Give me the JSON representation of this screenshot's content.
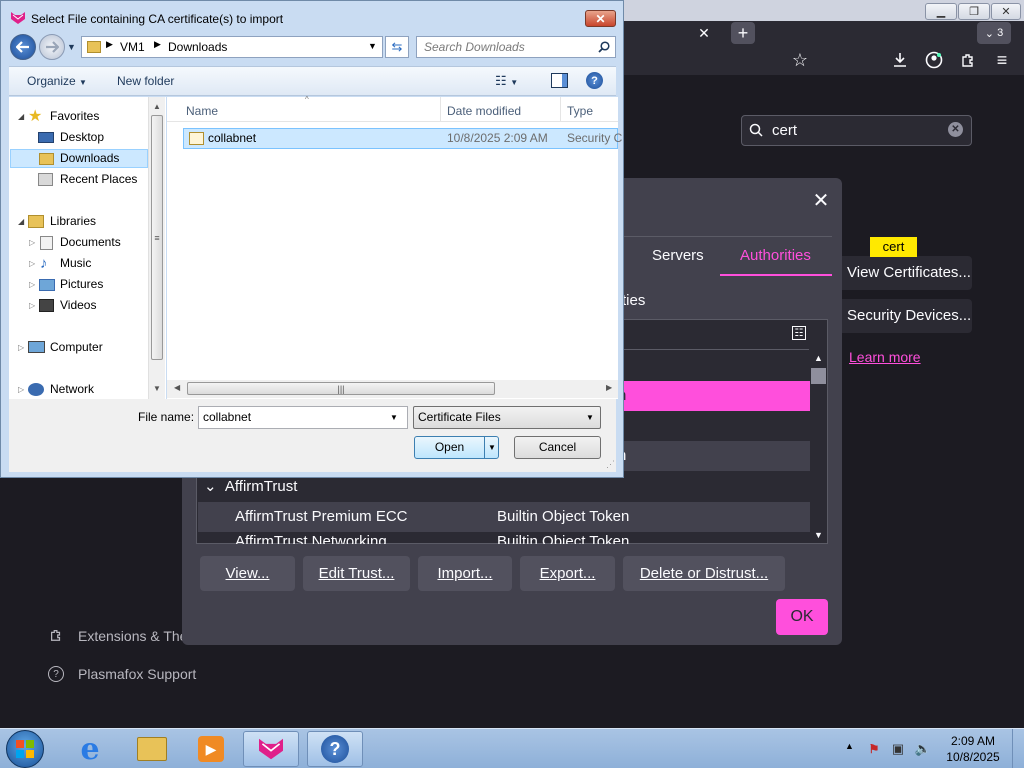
{
  "browser": {
    "tab_count": "3",
    "search_value": "cert",
    "view_certificates_label": "View Certificates...",
    "security_devices_label": "Security Devices...",
    "learn_more": "Learn more",
    "cert_tooltip": "cert",
    "sidebar": {
      "extensions": "Extensions & Themes",
      "support": "Plasmafox Support"
    }
  },
  "cert_manager": {
    "tabs": [
      "Servers",
      "Authorities"
    ],
    "active_tab": "Authorities",
    "desc_partial": "ties",
    "rows": [
      {
        "name": "AffirmTrust",
        "token": "",
        "group": true
      },
      {
        "name": "AffirmTrust Premium ECC",
        "token": "Builtin Object Token",
        "group": false
      },
      {
        "name": "AffirmTrust Networking",
        "token": "Builtin Object Token",
        "group": false
      }
    ],
    "partial_rows": [
      "n",
      "n"
    ],
    "buttons": {
      "view": "View...",
      "edit_trust": "Edit Trust...",
      "import": "Import...",
      "export": "Export...",
      "delete": "Delete or Distrust...",
      "ok": "OK"
    }
  },
  "file_dialog": {
    "title": "Select File containing CA certificate(s) to import",
    "address": [
      "VM1",
      "Downloads"
    ],
    "search_placeholder": "Search Downloads",
    "toolbar": {
      "organize": "Organize",
      "new_folder": "New folder"
    },
    "nav": {
      "favorites": "Favorites",
      "desktop": "Desktop",
      "downloads": "Downloads",
      "recent": "Recent Places",
      "libraries": "Libraries",
      "documents": "Documents",
      "music": "Music",
      "pictures": "Pictures",
      "videos": "Videos",
      "computer": "Computer",
      "network": "Network"
    },
    "columns": {
      "name": "Name",
      "date": "Date modified",
      "type": "Type"
    },
    "files": [
      {
        "name": "collabnet",
        "date": "10/8/2025 2:09 AM",
        "type": "Security C"
      }
    ],
    "filename_label": "File name:",
    "filename_value": "collabnet",
    "filter": "Certificate Files",
    "open": "Open",
    "cancel": "Cancel"
  },
  "taskbar": {
    "time": "2:09 AM",
    "date": "10/8/2025"
  },
  "colors": {
    "accent_pink": "#ff4fdc",
    "browser_bg": "#1c1b22",
    "selection_blue": "#cce8ff"
  }
}
